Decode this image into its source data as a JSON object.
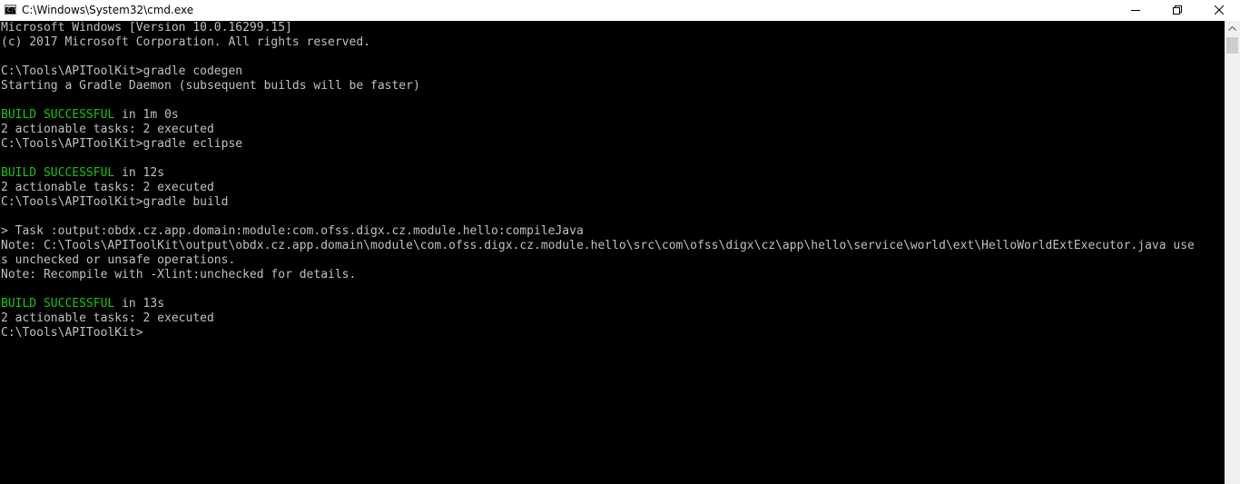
{
  "window": {
    "title": "C:\\Windows\\System32\\cmd.exe",
    "app_icon": "command-prompt-icon",
    "app_icon_glyph": "C:\\",
    "controls": [
      "minimize-icon",
      "maximize-icon",
      "close-icon"
    ]
  },
  "colors": {
    "background": "#000000",
    "text": "#c0c0c0",
    "success": "#16c60c"
  },
  "console": {
    "lines": [
      {
        "text": "Microsoft Windows [Version 10.0.16299.15]"
      },
      {
        "text": "(c) 2017 Microsoft Corporation. All rights reserved."
      },
      {
        "text": ""
      },
      {
        "text": "C:\\Tools\\APIToolKit>gradle codegen"
      },
      {
        "text": "Starting a Gradle Daemon (subsequent builds will be faster)"
      },
      {
        "text": ""
      },
      {
        "green": "BUILD SUCCESSFUL",
        "text": " in 1m 0s"
      },
      {
        "text": "2 actionable tasks: 2 executed"
      },
      {
        "text": "C:\\Tools\\APIToolKit>gradle eclipse"
      },
      {
        "text": ""
      },
      {
        "green": "BUILD SUCCESSFUL",
        "text": " in 12s"
      },
      {
        "text": "2 actionable tasks: 2 executed"
      },
      {
        "text": "C:\\Tools\\APIToolKit>gradle build"
      },
      {
        "text": ""
      },
      {
        "text": "> Task :output:obdx.cz.app.domain:module:com.ofss.digx.cz.module.hello:compileJava"
      },
      {
        "text": "Note: C:\\Tools\\APIToolKit\\output\\obdx.cz.app.domain\\module\\com.ofss.digx.cz.module.hello\\src\\com\\ofss\\digx\\cz\\app\\hello\\service\\world\\ext\\HelloWorldExtExecutor.java use"
      },
      {
        "text": "s unchecked or unsafe operations."
      },
      {
        "text": "Note: Recompile with -Xlint:unchecked for details."
      },
      {
        "text": ""
      },
      {
        "green": "BUILD SUCCESSFUL",
        "text": " in 13s"
      },
      {
        "text": "2 actionable tasks: 2 executed"
      },
      {
        "text": "C:\\Tools\\APIToolKit>"
      }
    ]
  }
}
